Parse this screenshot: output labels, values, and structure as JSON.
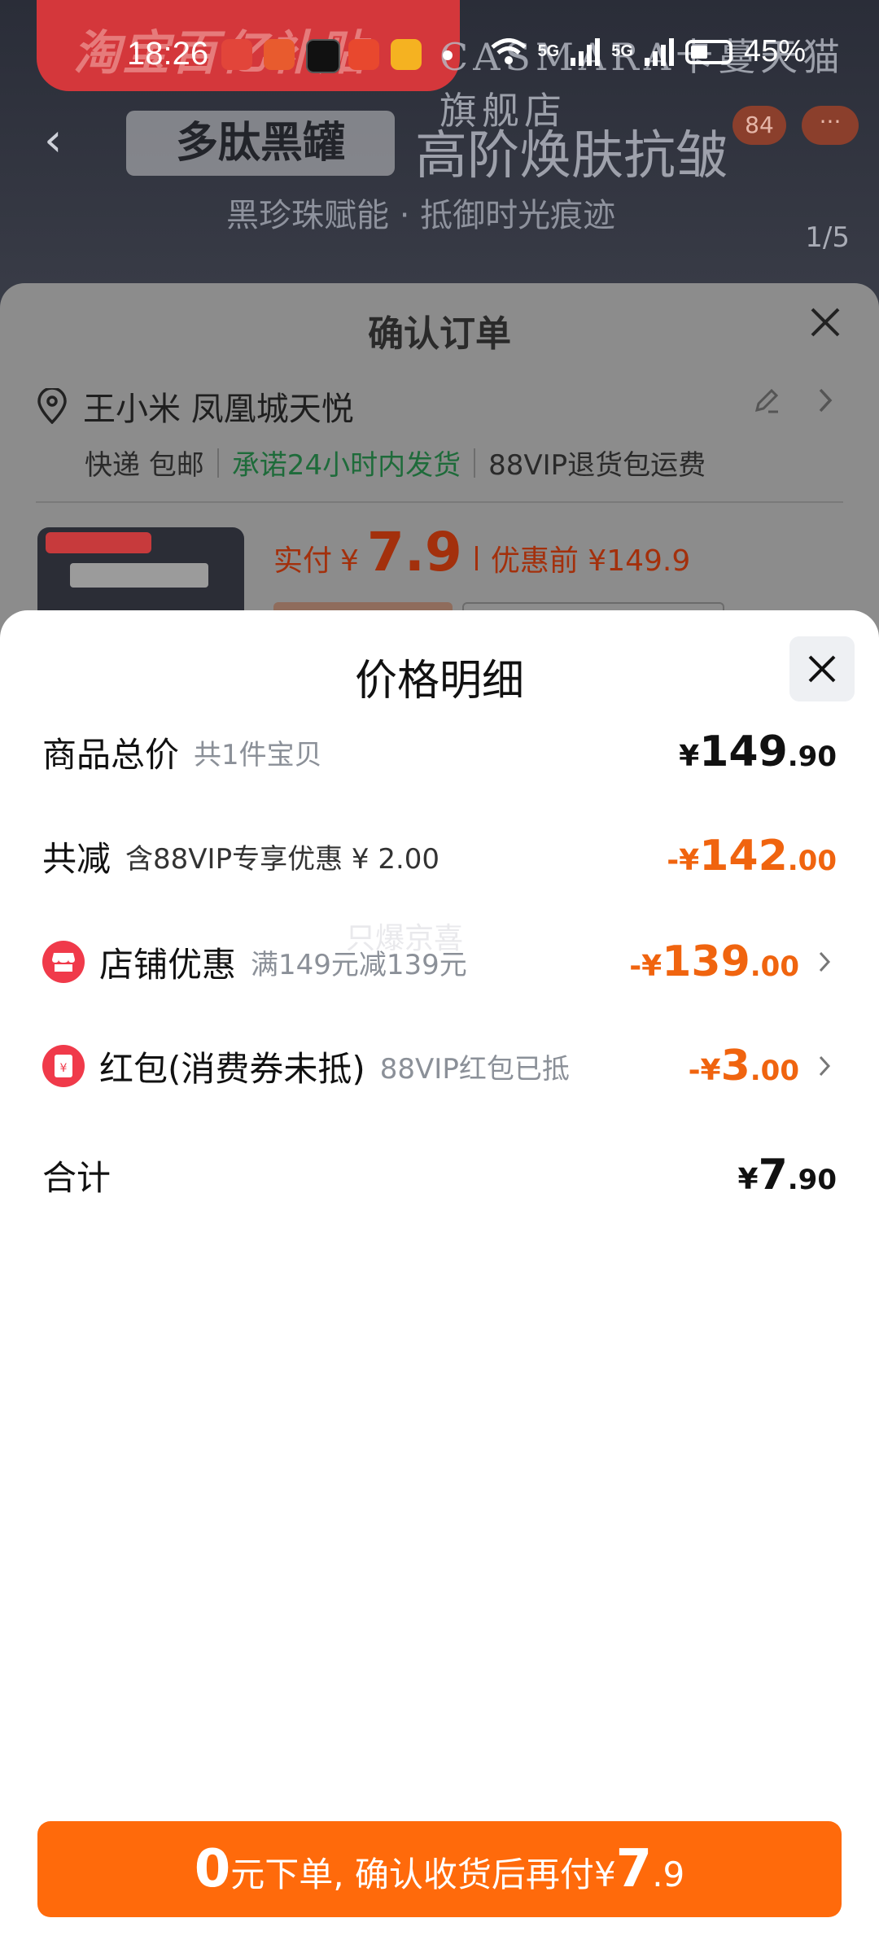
{
  "status_bar": {
    "time": "18:26",
    "battery": "45%",
    "net1": "5G",
    "net2": "5G"
  },
  "product_page": {
    "banner_text": "淘宝百亿补贴",
    "brand": "CASMARA卡蔓天猫旗舰店",
    "tag": "多肽黑罐",
    "title": "高阶焕肤抗皱",
    "subtitle": "黑珍珠赋能 · 抵御时光痕迹",
    "counter": "1/5",
    "badge_count": "84",
    "badge_more": "···"
  },
  "order_sheet": {
    "title": "确认订单",
    "address": "王小米 凤凰城天悦",
    "ship_method": "快递 包邮",
    "ship_promise": "承诺24小时内发货",
    "return_note": "88VIP退货包运费",
    "paid_label": "实付",
    "paid_cur": "¥",
    "paid_value": "7.9",
    "before_label": "优惠前 ¥149.9"
  },
  "detail": {
    "title": "价格明细",
    "watermark": "只爆京喜",
    "rows": [
      {
        "label": "商品总价",
        "note": "共1件宝贝",
        "cur": "¥",
        "int": "149",
        "dec": ".90"
      },
      {
        "label": "共减",
        "note": "含88VIP专享优惠 ¥ 2.00",
        "cur": "-¥",
        "int": "142",
        "dec": ".00"
      },
      {
        "label": "店铺优惠",
        "note": "满149元减139元",
        "cur": "-¥",
        "int": "139",
        "dec": ".00"
      },
      {
        "label": "红包(消费券未抵)",
        "note": "88VIP红包已抵",
        "cur": "-¥",
        "int": "3",
        "dec": ".00"
      },
      {
        "label": "合计",
        "note": "",
        "cur": "¥",
        "int": "7",
        "dec": ".90"
      }
    ]
  },
  "pay_button": {
    "zero": "0",
    "mid": "元下单, 确认收货后再付 ",
    "cur": "¥",
    "int": "7",
    "dec": ".9"
  },
  "colors": {
    "accent": "#ff6a0b",
    "discount": "#f0640f",
    "icon_red": "#f03a4a"
  }
}
